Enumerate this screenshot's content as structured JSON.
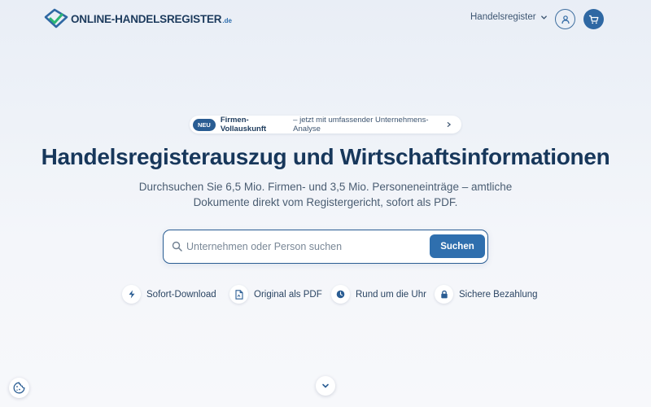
{
  "header": {
    "logo_text": "ONLINE-HANDELSREGISTER",
    "logo_tld": ".de",
    "nav_label": "Handelsregister",
    "account_icon": "user-icon",
    "cart_icon": "cart-icon"
  },
  "badge": {
    "tag": "NEU",
    "title": "Firmen-Vollauskunft",
    "text": "– jetzt mit umfassender Unternehmens-Analyse"
  },
  "hero": {
    "headline": "Handelsregisterauszug und Wirtschaftsinformationen",
    "subline_1": "Durchsuchen Sie 6,5 Mio. Firmen- und 3,5 Mio. Personeneinträge – amtliche",
    "subline_2": "Dokumente direkt vom Registergericht, sofort als PDF."
  },
  "search": {
    "placeholder": "Unternehmen oder Person suchen",
    "value": "",
    "button_label": "Suchen"
  },
  "features": [
    {
      "label": "Sofort-Download",
      "icon": "bolt-icon"
    },
    {
      "label": "Original als PDF",
      "icon": "pdf-icon"
    },
    {
      "label": "Rund um die Uhr",
      "icon": "clock-icon"
    },
    {
      "label": "Sichere Bezahlung",
      "icon": "lock-icon"
    }
  ],
  "colors": {
    "primary": "#2f6fae",
    "navy": "#17375b",
    "accent_green": "#2bb673"
  }
}
